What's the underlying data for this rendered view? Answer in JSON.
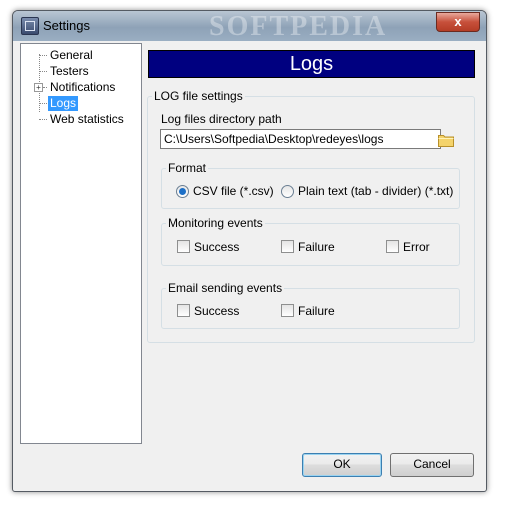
{
  "window": {
    "title": "Settings",
    "watermark": "SOFTPEDIA",
    "close_label": "x"
  },
  "tree": {
    "items": [
      {
        "label": "General",
        "selected": false
      },
      {
        "label": "Testers",
        "selected": false
      },
      {
        "label": "Notifications",
        "selected": false,
        "expandable": true
      },
      {
        "label": "Logs",
        "selected": true
      },
      {
        "label": "Web statistics",
        "selected": false
      }
    ],
    "expander_glyph": "+"
  },
  "header": {
    "title": "Logs"
  },
  "log_settings": {
    "group_label": "LOG file settings",
    "path_label": "Log files directory path",
    "path_value": "C:\\Users\\Softpedia\\Desktop\\redeyes\\logs",
    "browse_icon": "folder-icon"
  },
  "format": {
    "group_label": "Format",
    "options": [
      {
        "label": "CSV file (*.csv)",
        "selected": true
      },
      {
        "label": "Plain text (tab - divider) (*.txt)",
        "selected": false
      }
    ]
  },
  "monitoring": {
    "group_label": "Monitoring events",
    "options": [
      {
        "label": "Success",
        "checked": false
      },
      {
        "label": "Failure",
        "checked": false
      },
      {
        "label": "Error",
        "checked": false
      }
    ]
  },
  "email": {
    "group_label": "Email sending events",
    "options": [
      {
        "label": "Success",
        "checked": false
      },
      {
        "label": "Failure",
        "checked": false
      }
    ]
  },
  "buttons": {
    "ok": "OK",
    "cancel": "Cancel"
  },
  "colors": {
    "header_bg": "#000080",
    "selection": "#3399ff"
  }
}
